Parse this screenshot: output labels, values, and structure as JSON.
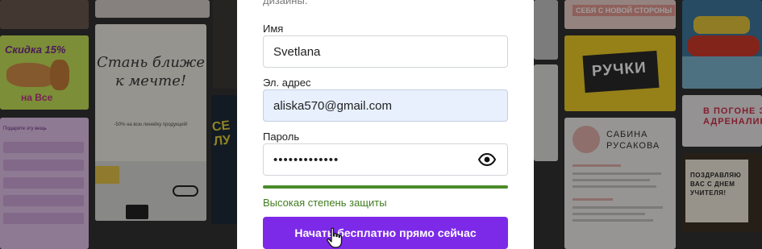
{
  "form": {
    "intro_fragment": "дизайны.",
    "name_label": "Имя",
    "name_value": "Svetlana",
    "email_label": "Эл. адрес",
    "email_value": "aliska570@gmail.com",
    "password_label": "Пароль",
    "password_mask": "•••••••••••••",
    "password_strength": "Высокая степень защиты",
    "submit_label": "Начать бесплатно прямо сейчас",
    "accent_color": "#7d2ae8",
    "strength_color": "#4c8c2b"
  },
  "background_templates": {
    "sale_text": "Скидка 15%",
    "sale_sub": "на Все",
    "dream_text": "Стань ближе к мечте!",
    "dream_sub": "-50% на всю линейку продукций!",
    "pink_text": "СЕБЯ С НОВОЙ СТОРОНЫ",
    "yellow_word": "РУЧКИ",
    "cv_name": "САБИНА РУСАКОВА",
    "adren_text": "В ПОГОНЕ З АДРЕНАЛИН",
    "teacher_text": "ПОЗДРАВЛЯЮ ВАС С ДНЕМ УЧИТЕЛЯ!",
    "strip_text": "СЕ ЛУ"
  }
}
